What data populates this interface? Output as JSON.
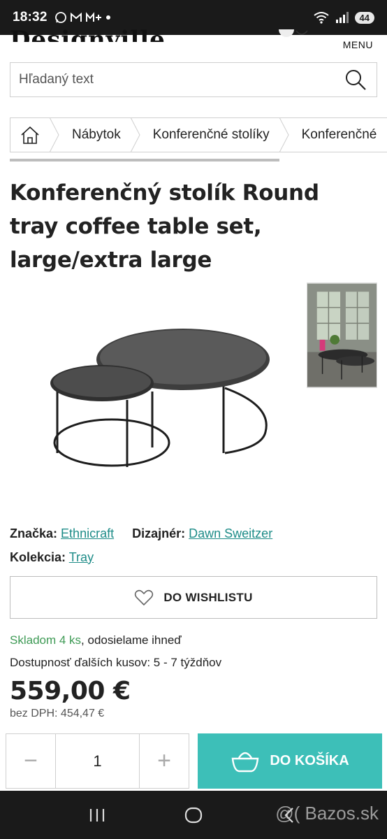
{
  "status_bar": {
    "time": "18:32",
    "battery": "44"
  },
  "header": {
    "logo": "Designville",
    "menu_label": "MENU"
  },
  "search": {
    "placeholder": "Hľadaný text"
  },
  "breadcrumb": {
    "items": [
      "Nábytok",
      "Konferenčné stolíky",
      "Konferenčné"
    ]
  },
  "product": {
    "title": "Konferenčný stolík Round tray coffee table set, large/extra large",
    "brand_label": "Značka:",
    "brand": "Ethnicraft",
    "designer_label": "Dizajnér:",
    "designer": "Dawn Sweitzer",
    "collection_label": "Kolekcia:",
    "collection": "Tray",
    "wishlist_label": "DO WISHLISTU",
    "stock_green": "Skladom 4 ks",
    "stock_rest": ", odosielame ihneď",
    "availability": "Dostupnosť ďalších kusov: 5 - 7 týždňov",
    "price": "559,00 €",
    "price_net": "bez DPH: 454,47 €",
    "quantity": "1",
    "minus": "−",
    "plus": "+",
    "cart_label": "DO KOŠÍKA"
  },
  "watermark": "@( Bazos.sk",
  "colors": {
    "accent": "#3dbfb8",
    "link": "#1e8c88",
    "stock": "#3e9a55"
  }
}
